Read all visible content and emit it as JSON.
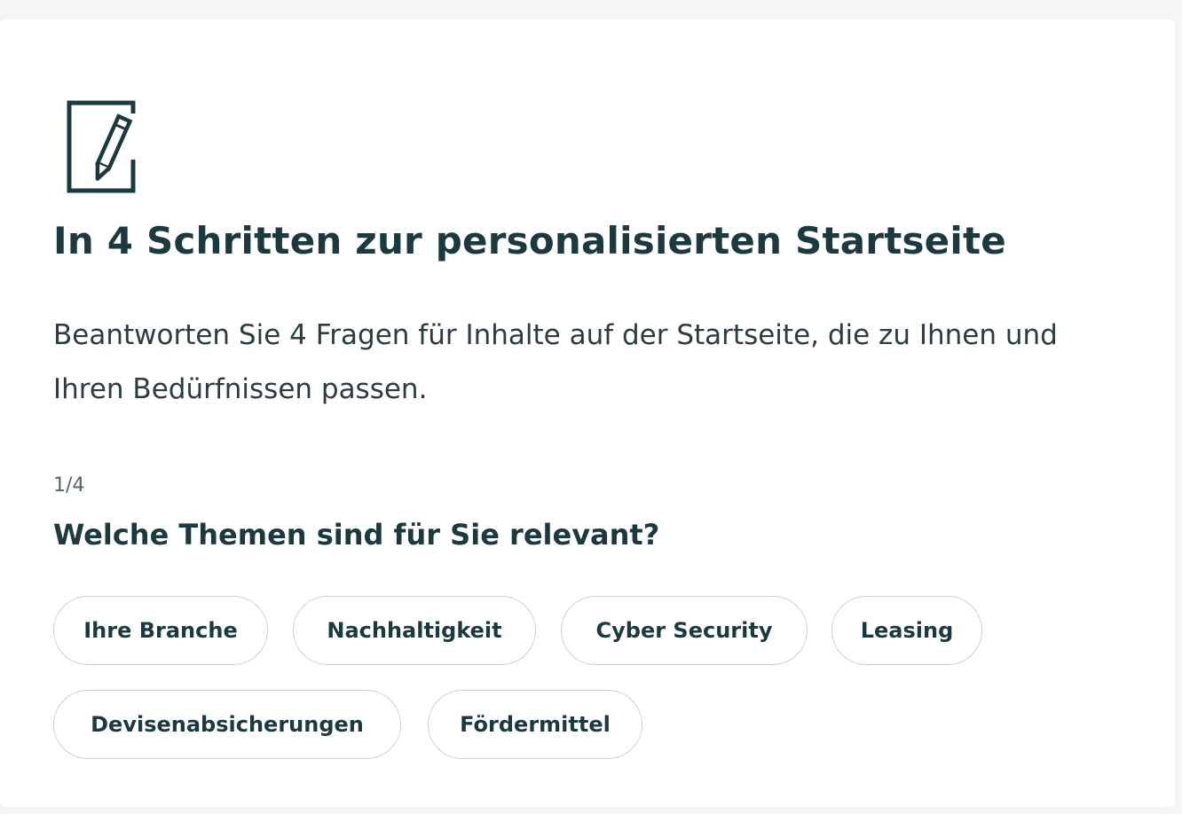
{
  "header": {
    "icon": "edit-note-icon",
    "title": "In 4 Schritten zur personalisierten Startseite",
    "intro": "Beantworten Sie 4 Fragen für Inhalte auf der Startseite, die zu Ihnen und Ihren Bedürfnissen passen."
  },
  "question": {
    "step": "1/4",
    "text": "Welche Themen sind für Sie relevant?",
    "options": [
      {
        "label": "Ihre Branche"
      },
      {
        "label": "Nachhaltigkeit"
      },
      {
        "label": "Cyber Security"
      },
      {
        "label": "Leasing"
      },
      {
        "label": "Devisenabsicherungen"
      },
      {
        "label": "Fördermittel"
      }
    ]
  },
  "colors": {
    "text_dark": "#1b3a40",
    "chip_border": "#c9d1d3",
    "background": "#ffffff"
  }
}
